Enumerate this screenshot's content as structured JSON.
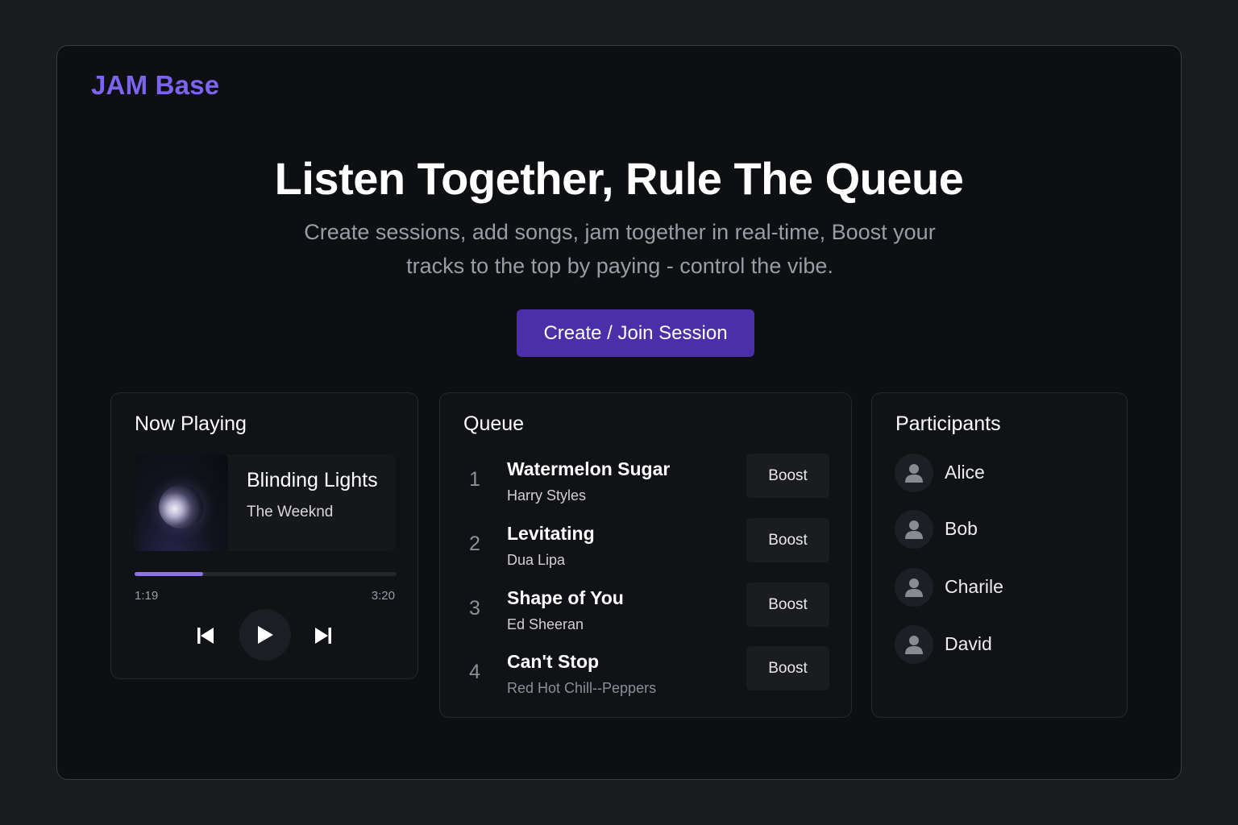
{
  "app": {
    "logo": "JAM Base"
  },
  "colors": {
    "accent": "#7c63f0",
    "button": "#4a2fa8",
    "progress": "#8a72e8"
  },
  "hero": {
    "title": "Listen Together, Rule The Queue",
    "subtitle": "Create sessions, add songs, jam together in real-time, Boost your tracks to the top by paying - control the vibe.",
    "cta_label": "Create / Join Session"
  },
  "now_playing": {
    "heading": "Now Playing",
    "track_title": "Blinding Lights",
    "track_artist": "The Weeknd",
    "current_time": "1:19",
    "total_time": "3:20",
    "progress_fraction": 0.26,
    "controls": [
      "previous-icon",
      "play-icon",
      "next-icon"
    ]
  },
  "queue": {
    "heading": "Queue",
    "boost_label": "Boost",
    "items": [
      {
        "number": "1",
        "title": "Watermelon Sugar",
        "artist": "Harry Styles"
      },
      {
        "number": "2",
        "title": "Levitating",
        "artist": "Dua Lipa"
      },
      {
        "number": "3",
        "title": "Shape of You",
        "artist": "Ed Sheeran"
      },
      {
        "number": "4",
        "title": "Can't Stop",
        "artist": "Red Hot Chill--Peppers"
      }
    ]
  },
  "participants": {
    "heading": "Participants",
    "items": [
      {
        "name": "Alice",
        "icon": "user-icon"
      },
      {
        "name": "Bob",
        "icon": "user-icon"
      },
      {
        "name": "Charile",
        "icon": "user-icon"
      },
      {
        "name": "David",
        "icon": "user-icon"
      }
    ]
  }
}
